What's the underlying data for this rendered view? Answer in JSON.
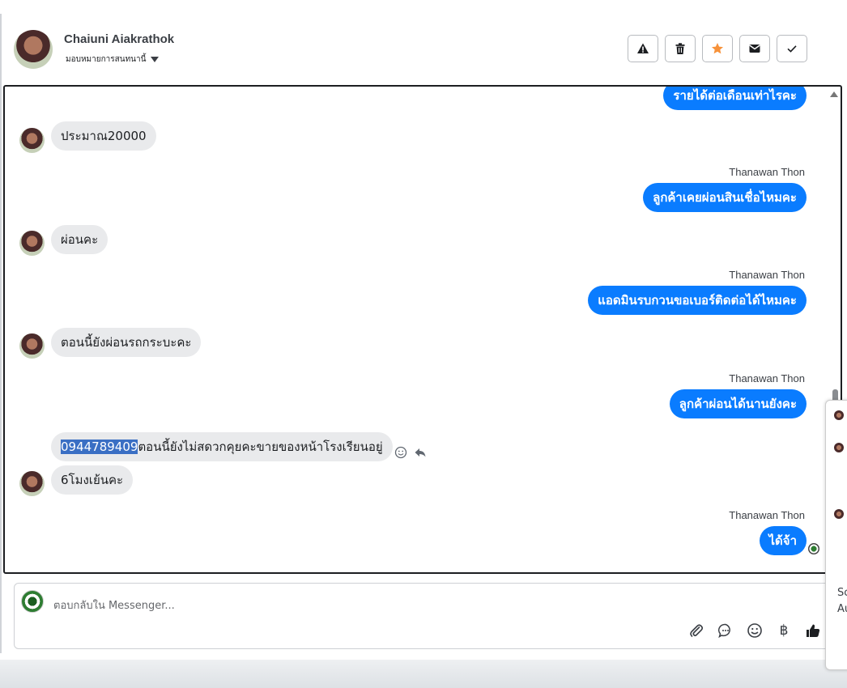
{
  "contact": {
    "name": "Chaiuni Aiakrathok",
    "assign_label": "มอบหมายการสนทนานี้"
  },
  "toolbar": {
    "buttons": [
      {
        "name": "spam-button",
        "icon": "warning-icon"
      },
      {
        "name": "delete-button",
        "icon": "trash-icon"
      },
      {
        "name": "star-button",
        "icon": "star-icon"
      },
      {
        "name": "mark-unread-button",
        "icon": "envelope-icon"
      },
      {
        "name": "done-button",
        "icon": "check-icon"
      }
    ]
  },
  "colors": {
    "outgoing": "#0a7cff",
    "incoming": "#e9eaec",
    "star": "#f7923a"
  },
  "messages": [
    {
      "dir": "out",
      "text": "รายได้ต่อเดือนเท่าไรคะ"
    },
    {
      "dir": "in",
      "text": "ประมาณ20000"
    },
    {
      "dir": "out",
      "sender": "Thanawan Thon",
      "text": "ลูกค้าเคยผ่อนสินเชื่อไหมคะ"
    },
    {
      "dir": "in",
      "text": "ผ่อนคะ"
    },
    {
      "dir": "out",
      "sender": "Thanawan Thon",
      "text": "แอดมินรบกวนขอเบอร์ติดต่อได้ไหมคะ"
    },
    {
      "dir": "in",
      "text": "ตอนนี้ยังผ่อนรถกระบะคะ"
    },
    {
      "dir": "out",
      "sender": "Thanawan Thon",
      "text": "ลูกค้าผ่อนได้นานยังคะ"
    },
    {
      "dir": "in",
      "text_highlight": "0944789409",
      "text_rest": "ตอนนี้ยังไม่สดวกคุยคะขายของหน้าโรงเรียนอยู่"
    },
    {
      "dir": "in",
      "text": "6โมงเย้นคะ"
    },
    {
      "dir": "out",
      "sender": "Thanawan Thon",
      "text": "ได้จ้า"
    }
  ],
  "composer": {
    "placeholder": "ตอบกลับใน Messenger...",
    "baht_symbol": "฿"
  },
  "right_panel": {
    "snippet1": "Sc",
    "snippet2": "Au"
  }
}
